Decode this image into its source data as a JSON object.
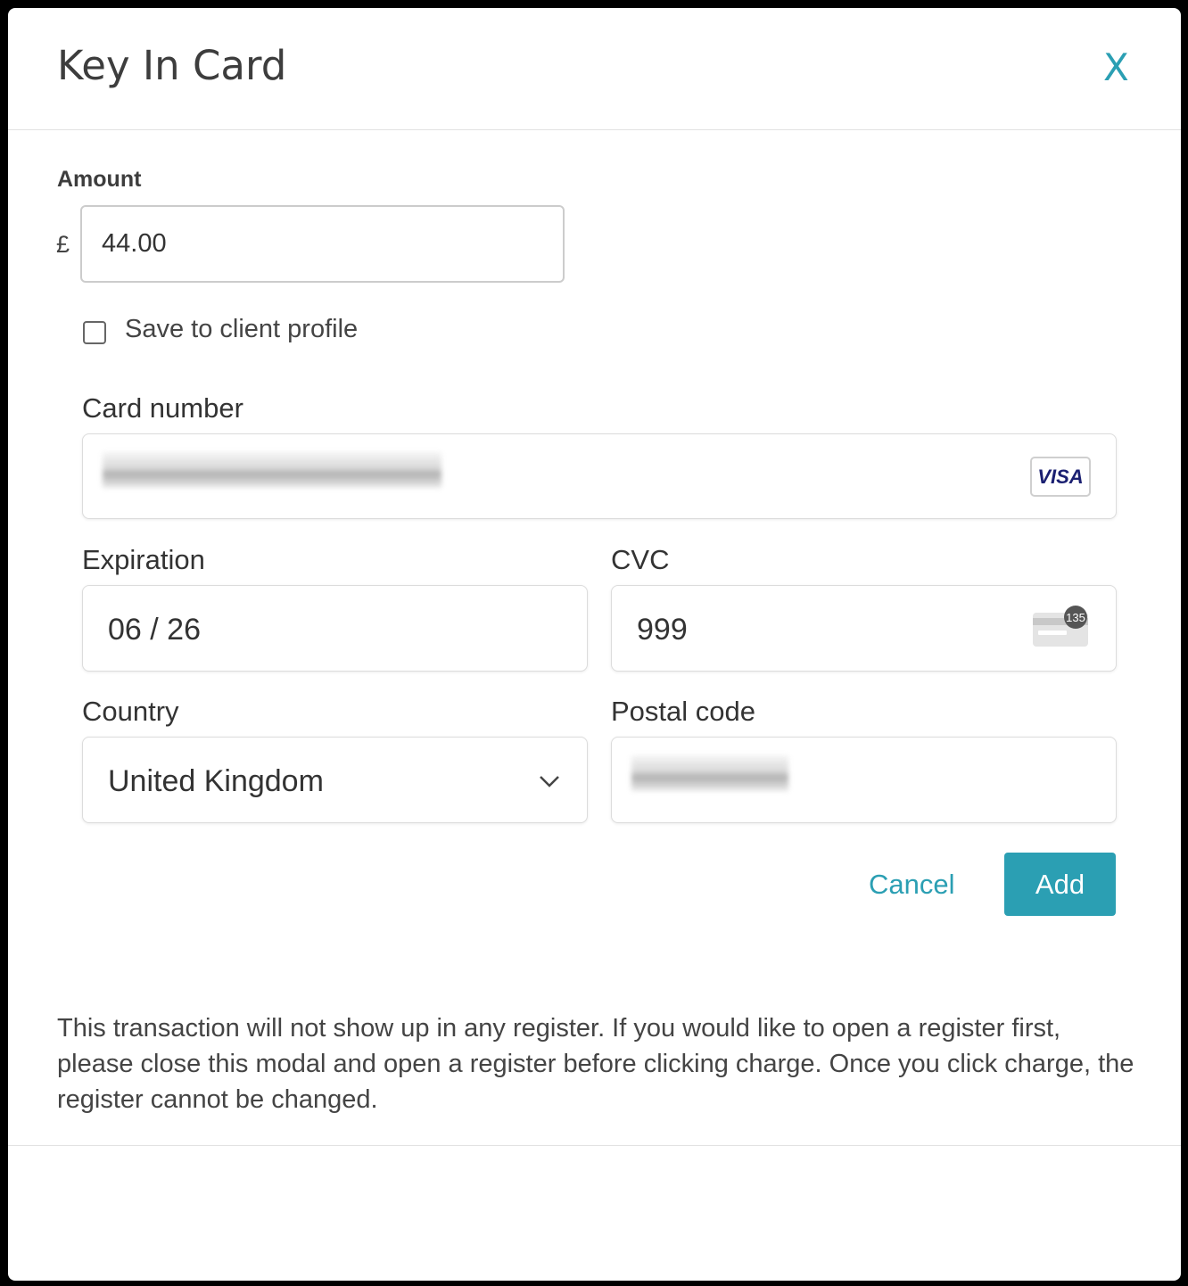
{
  "modal": {
    "title": "Key In Card",
    "close_label": "X"
  },
  "amount": {
    "label": "Amount",
    "currency_symbol": "£",
    "value": "44.00"
  },
  "save_profile": {
    "label": "Save to client profile",
    "checked": false
  },
  "card_number": {
    "label": "Card number",
    "value_redacted": true,
    "brand": "VISA"
  },
  "expiration": {
    "label": "Expiration",
    "value": "06 / 26"
  },
  "cvc": {
    "label": "CVC",
    "value": "999",
    "icon_badge": "135"
  },
  "country": {
    "label": "Country",
    "selected": "United Kingdom"
  },
  "postal_code": {
    "label": "Postal code",
    "value_redacted": true
  },
  "actions": {
    "cancel_label": "Cancel",
    "add_label": "Add"
  },
  "notice": "This transaction will not show up in any register. If you would like to open a register first, please close this modal and open a register before clicking charge. Once you click charge, the register cannot be changed.",
  "colors": {
    "accent": "#2b9fb3",
    "visa_blue": "#1a1f71"
  }
}
